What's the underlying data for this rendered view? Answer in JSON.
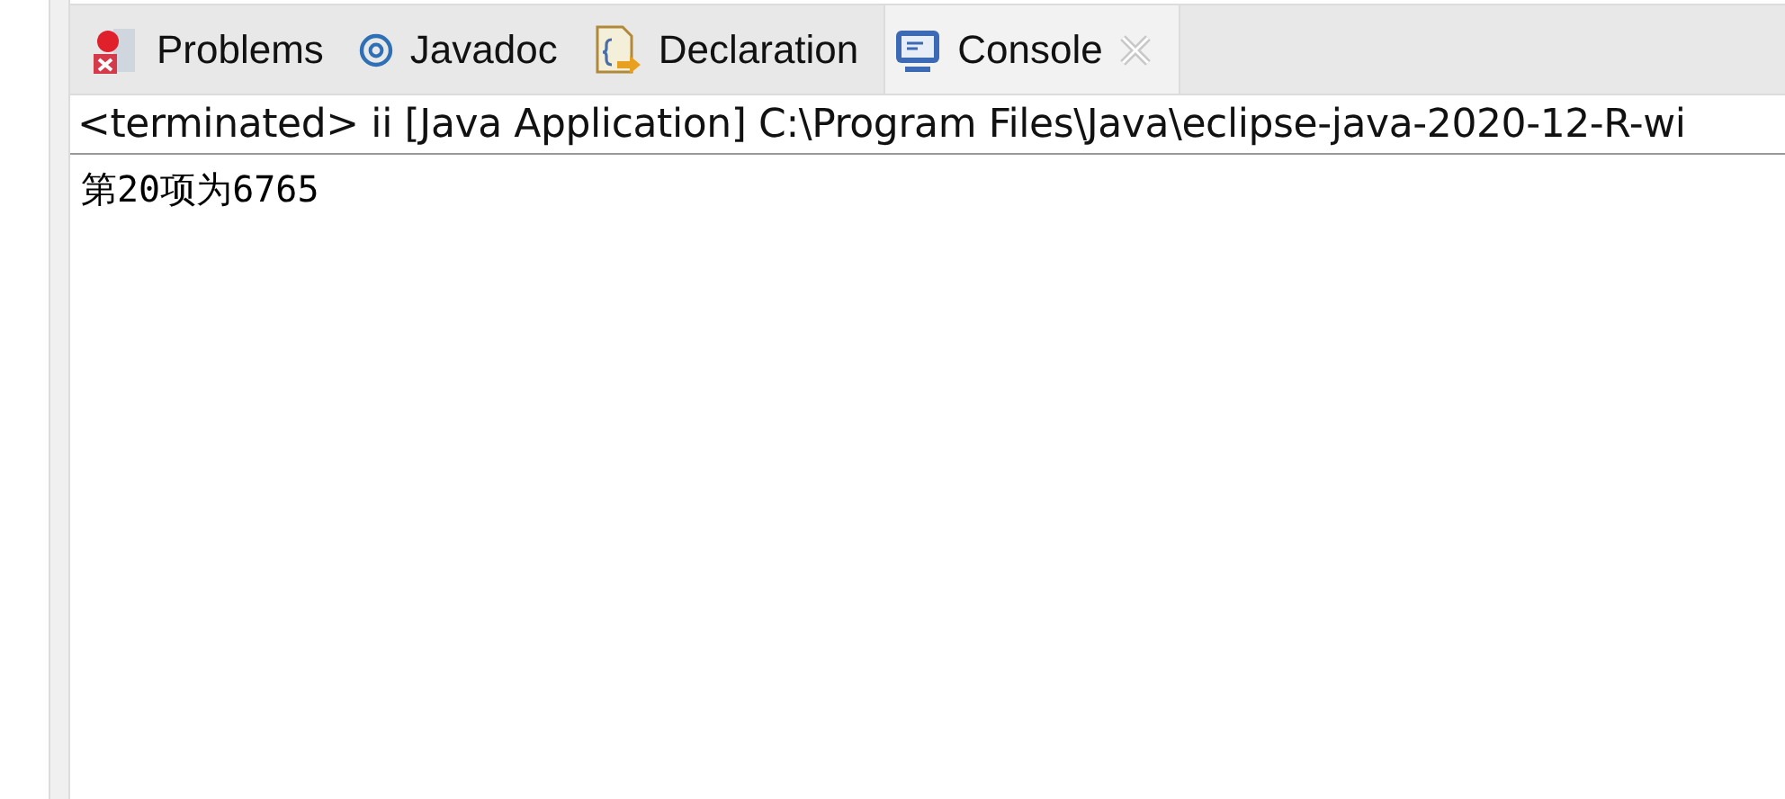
{
  "tabs": [
    {
      "label": "Problems",
      "kind": "problems",
      "selected": false
    },
    {
      "label": "Javadoc",
      "kind": "javadoc",
      "selected": false
    },
    {
      "label": "Declaration",
      "kind": "declaration",
      "selected": false
    },
    {
      "label": "Console",
      "kind": "console",
      "selected": true
    }
  ],
  "console": {
    "header": "<terminated> ii [Java Application] C:\\Program Files\\Java\\eclipse-java-2020-12-R-wi",
    "lines": [
      "第20项为6765"
    ]
  }
}
